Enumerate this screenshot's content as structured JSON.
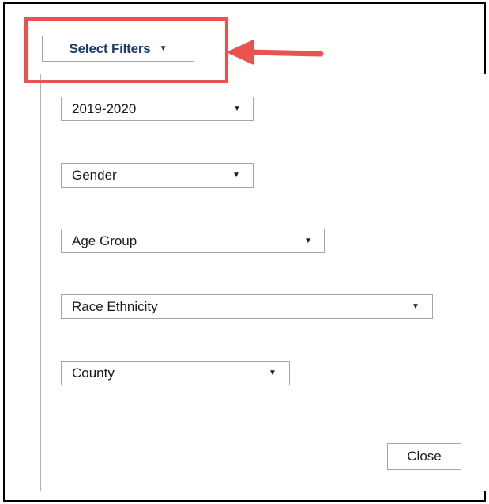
{
  "toolbar": {
    "select_filters_label": "Select Filters",
    "caret_glyph": "▼"
  },
  "filters": {
    "year": {
      "value": "2019-2020"
    },
    "gender": {
      "value": "Gender"
    },
    "age_group": {
      "value": "Age Group"
    },
    "race_ethnicity": {
      "value": "Race Ethnicity"
    },
    "county": {
      "value": "County"
    }
  },
  "actions": {
    "close_label": "Close"
  },
  "annotation": {
    "color": "#e8524f",
    "icon": "arrow-left-icon"
  },
  "colors": {
    "select_filters_text": "#1d3b6b",
    "panel_border": "#a9b4c4",
    "control_border": "#a6a6a6"
  }
}
